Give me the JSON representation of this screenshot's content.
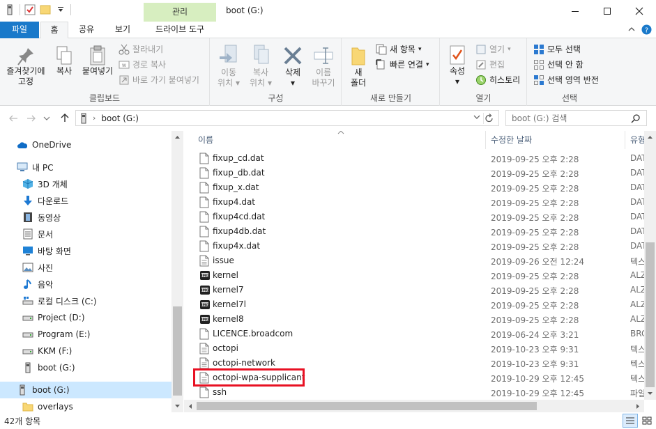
{
  "window": {
    "title": "boot (G:)",
    "context_tab": "관리"
  },
  "tabs": {
    "file": "파일",
    "home": "홈",
    "share": "공유",
    "view": "보기",
    "drive_tools": "드라이브 도구"
  },
  "ribbon": {
    "clipboard": {
      "label": "클립보드",
      "pin_line1": "즐겨찾기에",
      "pin_line2": "고정",
      "copy": "복사",
      "paste": "붙여넣기",
      "cut": "잘라내기",
      "copy_path": "경로 복사",
      "paste_shortcut": "바로 가기 붙여넣기"
    },
    "organize": {
      "label": "구성",
      "move_line1": "이동",
      "move_line2": "위치",
      "copyto_line1": "복사",
      "copyto_line2": "위치",
      "delete": "삭제",
      "rename_line1": "이름",
      "rename_line2": "바꾸기"
    },
    "new": {
      "label": "새로 만들기",
      "folder_line1": "새",
      "folder_line2": "폴더",
      "new_item": "새 항목",
      "easy_access": "빠른 연결"
    },
    "open": {
      "label": "열기",
      "properties": "속성",
      "open": "열기",
      "edit": "편집",
      "history": "히스토리"
    },
    "select": {
      "label": "선택",
      "select_all": "모두 선택",
      "select_none": "선택 안 함",
      "invert": "선택 영역 반전"
    }
  },
  "address": {
    "path": "boot (G:)",
    "search_placeholder": "boot (G:) 검색"
  },
  "nav": {
    "items": [
      {
        "label": "OneDrive"
      },
      {
        "label": "내 PC"
      },
      {
        "label": "3D 개체"
      },
      {
        "label": "다운로드"
      },
      {
        "label": "동영상"
      },
      {
        "label": "문서"
      },
      {
        "label": "바탕 화면"
      },
      {
        "label": "사진"
      },
      {
        "label": "음악"
      },
      {
        "label": "로컬 디스크 (C:)"
      },
      {
        "label": "Project (D:)"
      },
      {
        "label": "Program (E:)"
      },
      {
        "label": "KKM (F:)"
      },
      {
        "label": "boot (G:)"
      },
      {
        "label": "boot (G:)"
      },
      {
        "label": "overlays"
      }
    ]
  },
  "list": {
    "headers": {
      "name": "이름",
      "date": "수정한 날짜",
      "type": "유형"
    },
    "rows": [
      {
        "name": "fixup_cd.dat",
        "date": "2019-09-25 오후 2:28",
        "type": "DAT",
        "icon": "file-icon"
      },
      {
        "name": "fixup_db.dat",
        "date": "2019-09-25 오후 2:28",
        "type": "DAT",
        "icon": "file-icon"
      },
      {
        "name": "fixup_x.dat",
        "date": "2019-09-25 오후 2:28",
        "type": "DAT",
        "icon": "file-icon"
      },
      {
        "name": "fixup4.dat",
        "date": "2019-09-25 오후 2:28",
        "type": "DAT",
        "icon": "file-icon"
      },
      {
        "name": "fixup4cd.dat",
        "date": "2019-09-25 오후 2:28",
        "type": "DAT",
        "icon": "file-icon"
      },
      {
        "name": "fixup4db.dat",
        "date": "2019-09-25 오후 2:28",
        "type": "DAT",
        "icon": "file-icon"
      },
      {
        "name": "fixup4x.dat",
        "date": "2019-09-25 오후 2:28",
        "type": "DAT",
        "icon": "file-icon"
      },
      {
        "name": "issue",
        "date": "2019-09-26 오전 12:24",
        "type": "텍스",
        "icon": "text-file-icon"
      },
      {
        "name": "kernel",
        "date": "2019-09-25 오후 2:28",
        "type": "ALZ",
        "icon": "img-file-icon"
      },
      {
        "name": "kernel7",
        "date": "2019-09-25 오후 2:28",
        "type": "ALZ",
        "icon": "img-file-icon"
      },
      {
        "name": "kernel7l",
        "date": "2019-09-25 오후 2:28",
        "type": "ALZ",
        "icon": "img-file-icon"
      },
      {
        "name": "kernel8",
        "date": "2019-09-25 오후 2:28",
        "type": "ALZ",
        "icon": "img-file-icon"
      },
      {
        "name": "LICENCE.broadcom",
        "date": "2019-06-24 오후 3:21",
        "type": "BRC",
        "icon": "file-icon"
      },
      {
        "name": "octopi",
        "date": "2019-10-23 오후 9:31",
        "type": "텍스",
        "icon": "text-file-icon"
      },
      {
        "name": "octopi-network",
        "date": "2019-10-23 오후 9:31",
        "type": "텍스",
        "icon": "text-file-icon"
      },
      {
        "name": "octopi-wpa-supplicant",
        "date": "2019-10-29 오후 12:45",
        "type": "텍스",
        "icon": "text-file-icon"
      },
      {
        "name": "ssh",
        "date": "2019-10-29 오후 12:45",
        "type": "파일",
        "icon": "file-icon"
      }
    ]
  },
  "status": {
    "count": "42개 항목"
  },
  "colors": {
    "accent": "#1979ca",
    "highlight": "#e81123",
    "nav_selected": "#cce8ff",
    "context_tab": "#d7eec0"
  }
}
